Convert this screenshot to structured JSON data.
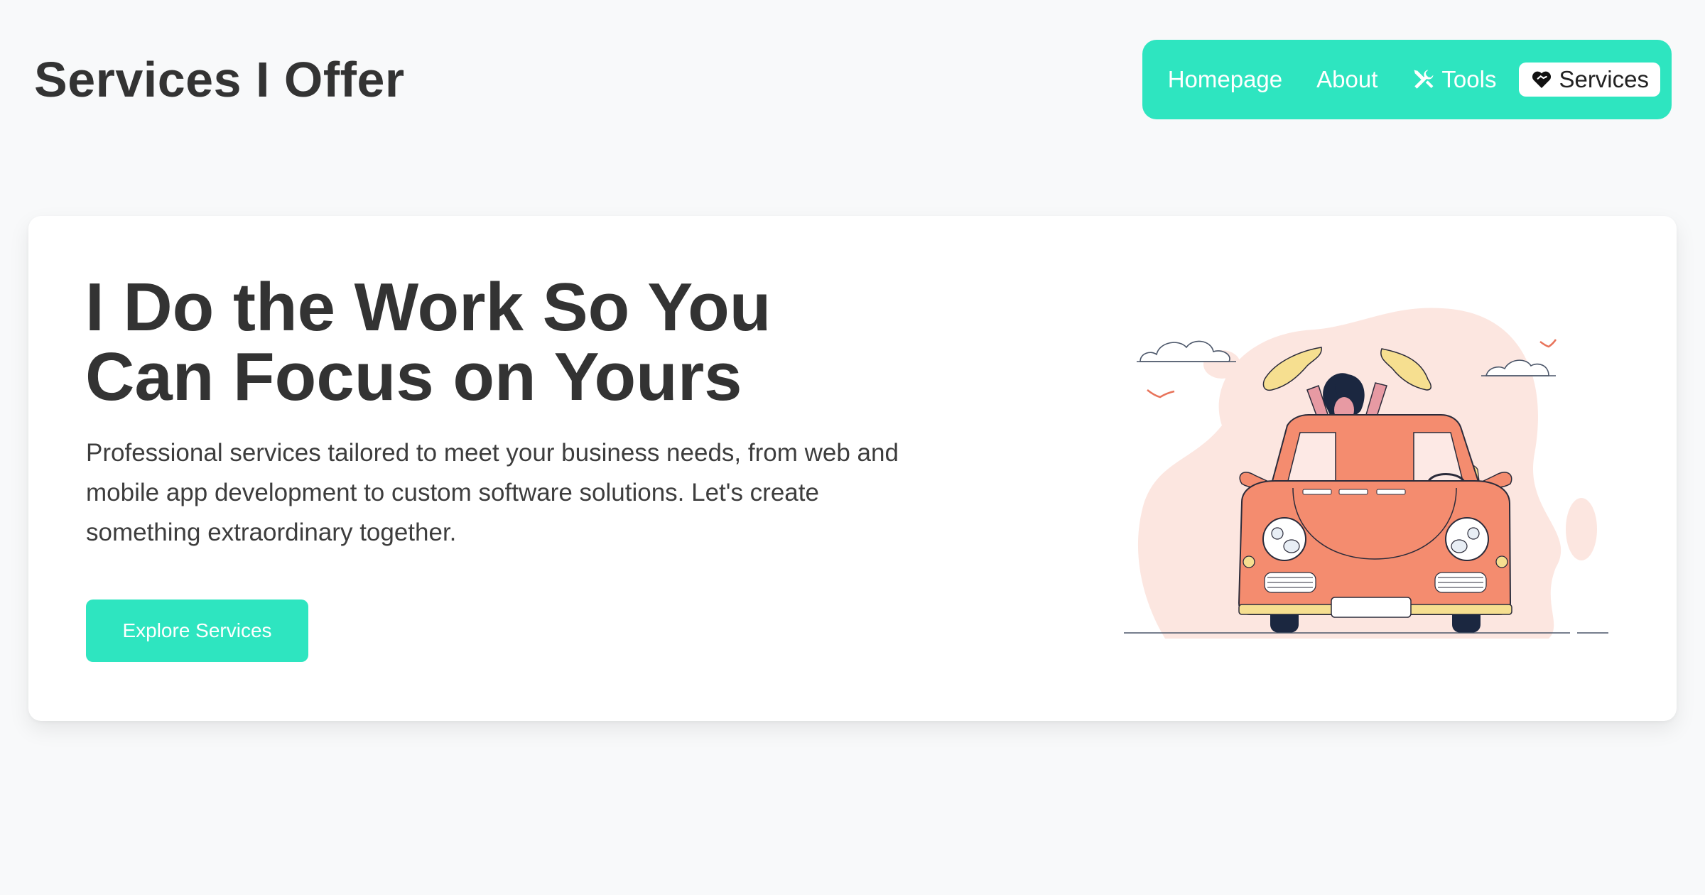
{
  "header": {
    "title": "Services I Offer"
  },
  "nav": {
    "items": [
      {
        "label": "Homepage",
        "icon": null,
        "active": false
      },
      {
        "label": "About",
        "icon": null,
        "active": false
      },
      {
        "label": "Tools",
        "icon": "tools-icon",
        "active": false
      },
      {
        "label": "Services",
        "icon": "heart-handshake-icon",
        "active": true
      }
    ]
  },
  "hero": {
    "title": "I Do the Work So You Can Focus on Yours",
    "description": "Professional services tailored to meet your business needs, from web and mobile app development to custom software solutions. Let's create something extraordinary together.",
    "cta_label": "Explore Services"
  },
  "colors": {
    "accent": "#2ee5c0",
    "background": "#f8f9fa",
    "card": "#ffffff",
    "text": "#333333"
  }
}
